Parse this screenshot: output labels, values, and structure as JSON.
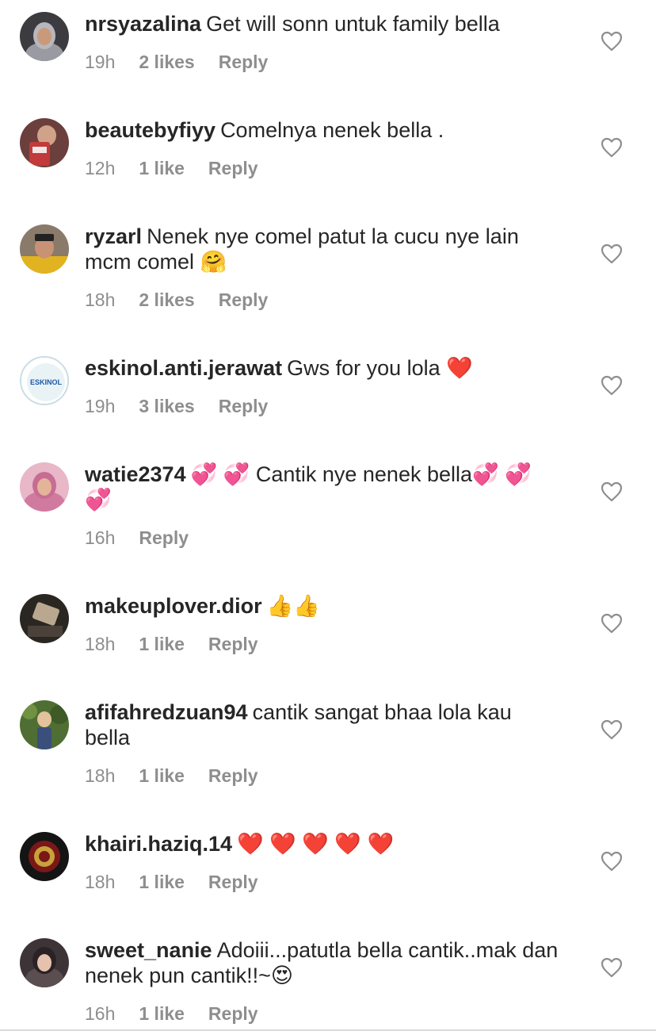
{
  "comments": [
    {
      "username": "nrsyazalina",
      "text": "Get will sonn untuk family bella",
      "time": "19h",
      "likes": "2 likes",
      "reply": "Reply",
      "avatar_color": "#3b3b40"
    },
    {
      "username": "beautebyfiyy",
      "text": "Comelnya nenek bella .",
      "time": "12h",
      "likes": "1 like",
      "reply": "Reply",
      "avatar_color": "#8a4a44"
    },
    {
      "username": "ryzarl",
      "text": "Nenek nye comel patut la cucu nye lain mcm comel 🤗",
      "time": "18h",
      "likes": "2 likes",
      "reply": "Reply",
      "avatar_color": "#c9a23a"
    },
    {
      "username": "eskinol.anti.jerawat",
      "text": "Gws for you lola ❤️",
      "time": "19h",
      "likes": "3 likes",
      "reply": "Reply",
      "avatar_color": "#e9f3f6",
      "avatar_logo": "ESKINOL"
    },
    {
      "username": "watie2374",
      "text": "💞 💞 Cantik nye nenek bella💞 💞 💞",
      "time": "16h",
      "likes": "",
      "reply": "Reply",
      "avatar_color": "#d98aa8"
    },
    {
      "username": "makeuplover.dior",
      "text": "👍👍",
      "time": "18h",
      "likes": "1 like",
      "reply": "Reply",
      "avatar_color": "#3a3530"
    },
    {
      "username": "afifahredzuan94",
      "text": "cantik sangat bhaa lola kau bella",
      "time": "18h",
      "likes": "1 like",
      "reply": "Reply",
      "avatar_color": "#5d7a3a"
    },
    {
      "username": "khairi.haziq.14",
      "text": "❤️ ❤️ ❤️ ❤️ ❤️",
      "time": "18h",
      "likes": "1 like",
      "reply": "Reply",
      "avatar_color": "#1a1a1a"
    },
    {
      "username": "sweet_nanie",
      "text": "Adoiii...patutla bella cantik..mak dan nenek pun cantik!!~😍",
      "time": "16h",
      "likes": "1 like",
      "reply": "Reply",
      "avatar_color": "#4a4042"
    }
  ],
  "colors": {
    "text": "#262626",
    "meta": "#8e8e8e",
    "heart_stroke": "#8e8e8e",
    "divider": "#dbdbdb"
  },
  "icons": {
    "like": "heart-outline-icon"
  }
}
